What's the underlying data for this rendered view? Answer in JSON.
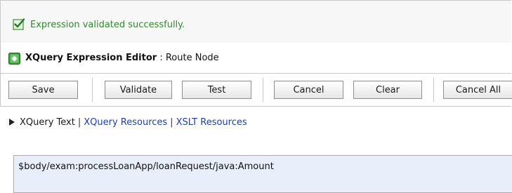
{
  "status": {
    "message": "Expression validated successfully.",
    "icon": "checkbox-check-icon",
    "color": "#2f8a2f"
  },
  "editor_header": {
    "icon": "expand-icon",
    "title": "XQuery Expression Editor",
    "separator": " : ",
    "subtitle": "Route Node"
  },
  "toolbar": {
    "save": "Save",
    "validate": "Validate",
    "test": "Test",
    "cancel": "Cancel",
    "clear": "Clear",
    "cancel_all": "Cancel All"
  },
  "nav": {
    "current": "XQuery Text",
    "xquery_resources": "XQuery Resources",
    "xslt_resources": "XSLT Resources",
    "separator": "|"
  },
  "expression": {
    "value": "$body/exam:processLoanApp/loanRequest/java:Amount"
  }
}
